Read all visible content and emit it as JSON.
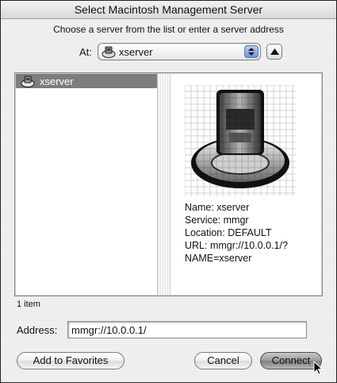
{
  "window": {
    "title": "Select Macintosh Management Server"
  },
  "instruction": "Choose a server from the list or enter a server address",
  "location": {
    "label": "At:",
    "selected": "xserver",
    "icon": "xserve-icon"
  },
  "browser": {
    "items": [
      {
        "label": "xserver",
        "icon": "xserve-icon",
        "selected": true
      }
    ],
    "preview": {
      "icon": "xserve-large-icon",
      "lines": [
        "Name: xserver",
        "Service: mmgr",
        "Location: DEFAULT",
        "URL: mmgr://10.0.0.1/?",
        "NAME=xserver"
      ]
    }
  },
  "item_count": "1 item",
  "address": {
    "label": "Address:",
    "value": "mmgr://10.0.0.1/"
  },
  "buttons": {
    "favorites": "Add to Favorites",
    "cancel": "Cancel",
    "connect": "Connect"
  }
}
